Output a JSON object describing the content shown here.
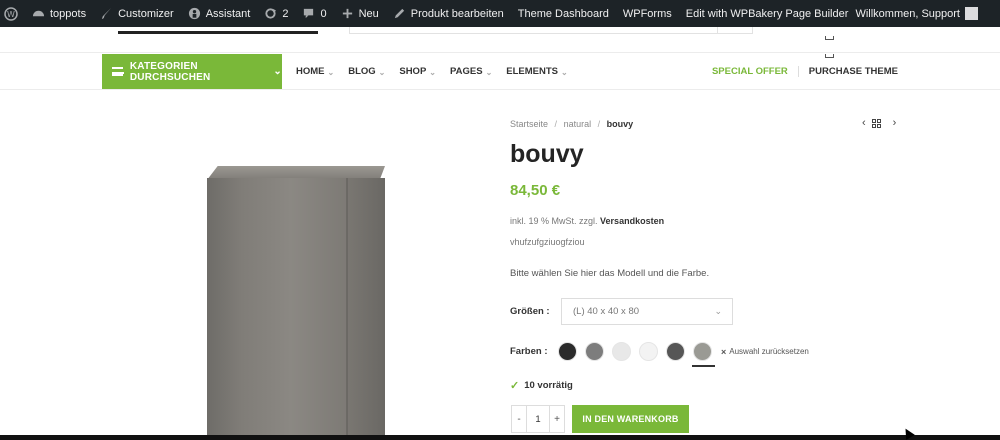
{
  "adminbar": {
    "site_name": "toppots",
    "customizer": "Customizer",
    "assistant": "Assistant",
    "updates_count": "2",
    "comments_count": "0",
    "new_label": "Neu",
    "edit_product": "Produkt bearbeiten",
    "theme_dashboard": "Theme Dashboard",
    "wpforms": "WPForms",
    "wpbakery": "Edit with WPBakery Page Builder",
    "welcome": "Willkommen, Support"
  },
  "nav": {
    "categories_button": "KATEGORIEN DURCHSUCHEN",
    "items": [
      {
        "label": "HOME",
        "has_dropdown": true
      },
      {
        "label": "BLOG",
        "has_dropdown": true
      },
      {
        "label": "SHOP",
        "has_dropdown": true
      },
      {
        "label": "PAGES",
        "has_dropdown": true
      },
      {
        "label": "ELEMENTS",
        "has_dropdown": true
      }
    ],
    "special_offer": "SPECIAL OFFER",
    "purchase_theme": "PURCHASE THEME"
  },
  "breadcrumb": {
    "home": "Startseite",
    "category": "natural",
    "current": "bouvy",
    "separator": "/"
  },
  "product": {
    "title": "bouvy",
    "price": "84,50 €",
    "tax_prefix": "inkl. 19 % MwSt. zzgl.",
    "shipping_link": "Versandkosten",
    "short_description": "vhufzufgziuogfziou",
    "choose_text": "Bitte wählen Sie hier das Modell und die Farbe.",
    "size_label": "Größen",
    "size_value": "(L) 40 x 40 x 80",
    "color_label": "Farben",
    "colors": [
      {
        "name": "black",
        "hex": "#2b2b2b",
        "selected": false
      },
      {
        "name": "grey",
        "hex": "#7d7d7d",
        "selected": false
      },
      {
        "name": "light-grey",
        "hex": "#e8e8e8",
        "selected": false
      },
      {
        "name": "white",
        "hex": "#f3f3f3",
        "selected": false
      },
      {
        "name": "dark-grey",
        "hex": "#565656",
        "selected": false
      },
      {
        "name": "stone",
        "hex": "#9a9a94",
        "selected": true
      }
    ],
    "reset_label": "Auswahl zurücksetzen",
    "stock_text": "10 vorrätig",
    "quantity": "1",
    "qty_minus": "-",
    "qty_plus": "+",
    "add_to_cart": "IN DEN WARENKORB"
  },
  "colors": {
    "accent": "#7ab839",
    "adminbar_bg": "#1d2327"
  }
}
